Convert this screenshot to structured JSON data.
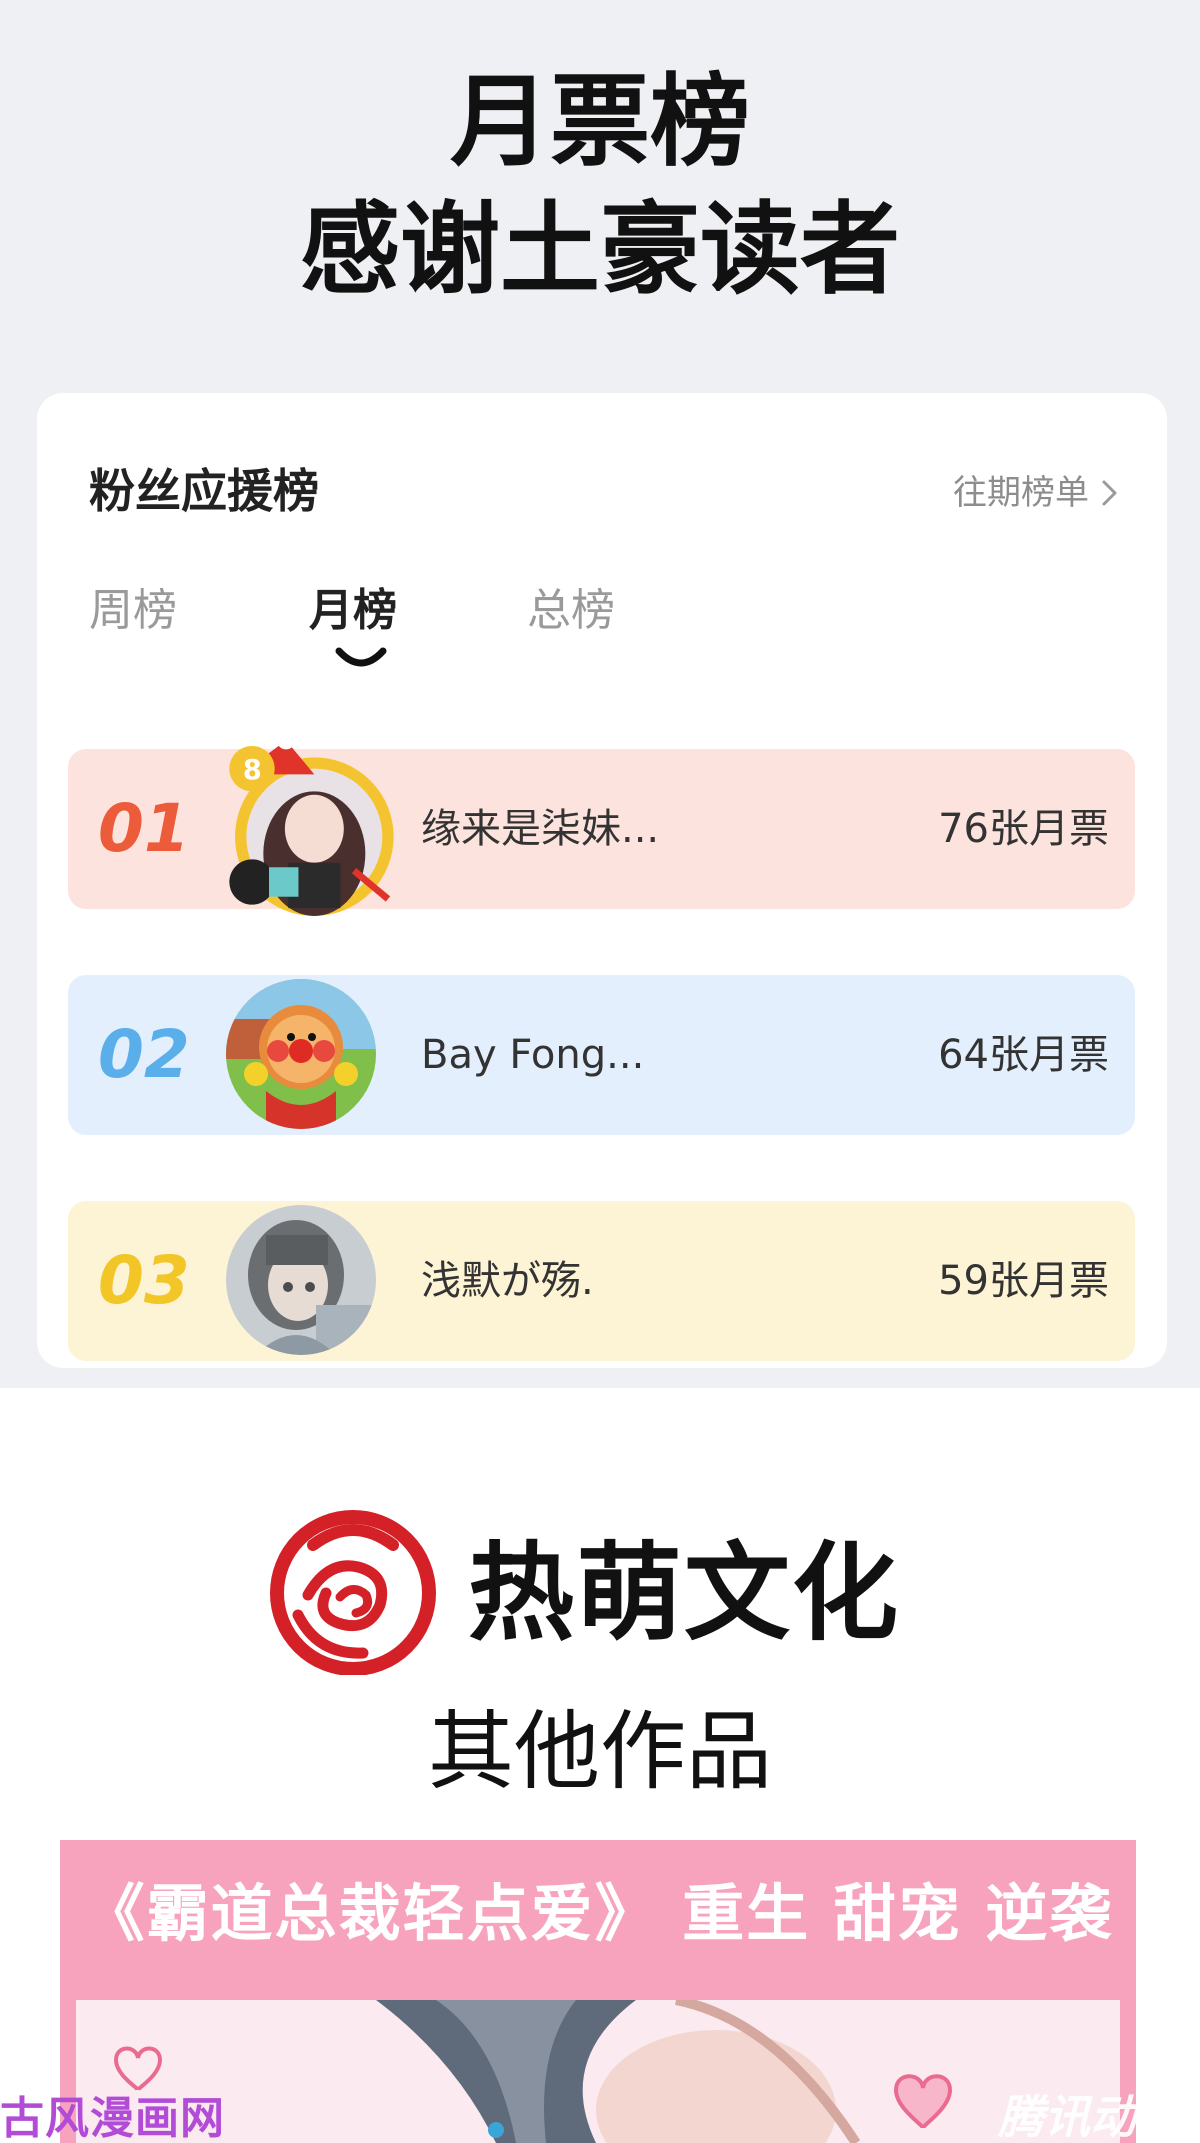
{
  "headline": {
    "line1": "月票榜",
    "line2": "感谢土豪读者"
  },
  "fan_board": {
    "title": "粉丝应援榜",
    "history_link": "往期榜单",
    "tabs": [
      {
        "label": "周榜",
        "active": false
      },
      {
        "label": "月榜",
        "active": true
      },
      {
        "label": "总榜",
        "active": false
      }
    ],
    "entries": [
      {
        "rank": "01",
        "name": "缘来是柒妹...",
        "votes": "76张月票",
        "avatar": "anime-girl-avatar",
        "color": "#ec5c3b"
      },
      {
        "rank": "02",
        "name": "Bay Fong...",
        "votes": "64张月票",
        "avatar": "cartoon-hero-avatar",
        "color": "#5aaeea"
      },
      {
        "rank": "03",
        "name": "浅默が殇.",
        "votes": "59张月票",
        "avatar": "anime-boy-avatar",
        "color": "#f2c627"
      }
    ]
  },
  "brand": {
    "name": "热萌文化",
    "subtitle": "其他作品",
    "logo_color": "#d42027"
  },
  "promo": {
    "title": "《霸道总裁轻点爱》 重生 甜宠 逆袭",
    "background": "#f7a3bd"
  },
  "watermarks": {
    "left": "古风漫画网",
    "right": "腾讯动漫"
  }
}
